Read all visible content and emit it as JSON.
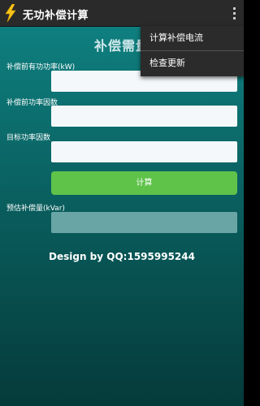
{
  "app": {
    "title": "无功补偿计算",
    "icon": "lightning-bolt-icon",
    "overflow_icon": "more-vert-icon"
  },
  "form": {
    "heading": "补偿需量",
    "active_power_label": "补偿前有功功率(kW)",
    "active_power_value": "",
    "power_factor_before_label": "补偿前功率因数",
    "power_factor_before_value": "",
    "target_power_factor_label": "目标功率因数",
    "target_power_factor_value": "",
    "calculate_label": "计算",
    "result_label": "预估补偿量(kVar)",
    "result_value": ""
  },
  "credit": "Design by QQ:1595995244",
  "menu": {
    "items": [
      {
        "label": "计算补偿电流"
      },
      {
        "label": "检查更新"
      }
    ]
  },
  "colors": {
    "actionbar": "#2a2a2a",
    "background_top": "#0f7f7f",
    "background_bottom": "#053a3a",
    "button_green": "#5fc34a",
    "input_bg": "#f4f8fb",
    "result_bg": "#6aa5a6"
  }
}
